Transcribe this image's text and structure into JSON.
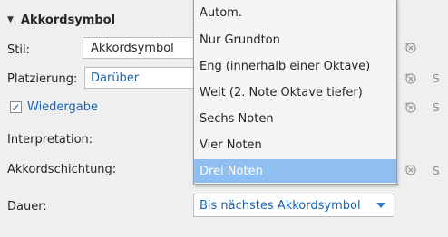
{
  "section": {
    "title": "Akkordsymbol"
  },
  "rows": {
    "stil": {
      "label": "Stil:",
      "value": "Akkordsymbol"
    },
    "platzierung": {
      "label": "Platzierung:",
      "value": "Darüber"
    },
    "wiedergabe": {
      "label": "Wiedergabe",
      "checked": true
    },
    "interpretation": {
      "label": "Interpretation:"
    },
    "akkordschichtung": {
      "label": "Akkordschichtung:"
    },
    "dauer": {
      "label": "Dauer:",
      "value": "Bis nächstes Akkordsymbol"
    }
  },
  "style_labels": {
    "platzierung": "S",
    "wiedergabe": "S",
    "akkordschichtung": "S"
  },
  "dropdown": {
    "items": [
      "Autom.",
      "Nur Grundton",
      "Eng (innerhalb einer Oktave)",
      "Weit (2. Note Oktave tiefer)",
      "Sechs Noten",
      "Vier Noten",
      "Drei Noten"
    ],
    "selected": "Drei Noten"
  },
  "icons": {
    "section_toggle": "collapse-triangle-icon",
    "reset": "reset-to-default-icon",
    "check": "checkmark-icon",
    "dropdown": "chevron-down-icon"
  },
  "colors": {
    "accent": "#1a64b4",
    "selection": "#8fbff0",
    "background": "#efefef"
  }
}
